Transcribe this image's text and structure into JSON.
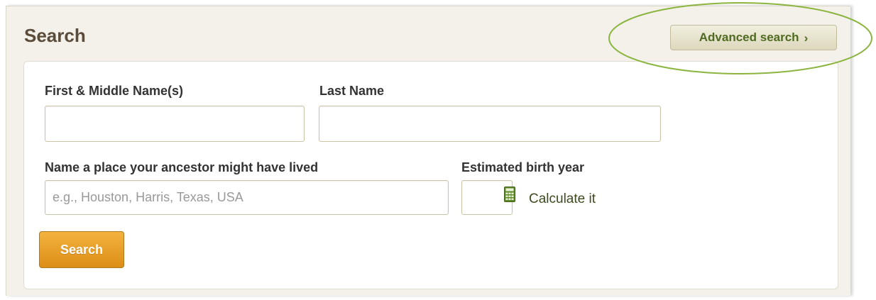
{
  "panel": {
    "title": "Search"
  },
  "advanced_search": {
    "label": "Advanced search",
    "chevron": "›"
  },
  "form": {
    "first_name": {
      "label": "First & Middle Name(s)",
      "value": "",
      "placeholder": ""
    },
    "last_name": {
      "label": "Last Name",
      "value": "",
      "placeholder": ""
    },
    "place": {
      "label": "Name a place your ancestor might have lived",
      "value": "",
      "placeholder": "e.g., Houston, Harris, Texas, USA"
    },
    "birth_year": {
      "label": "Estimated birth year",
      "value": "",
      "placeholder": ""
    },
    "calculate_link": "Calculate it",
    "calculator_icon": "calculator-icon",
    "search_button": "Search"
  },
  "colors": {
    "title": "#5b4b3a",
    "advanced_text": "#4f6b22",
    "highlight_ellipse": "#8bb53f",
    "search_button": "#e7a12c",
    "calculator_icon": "#5f8a2a"
  }
}
